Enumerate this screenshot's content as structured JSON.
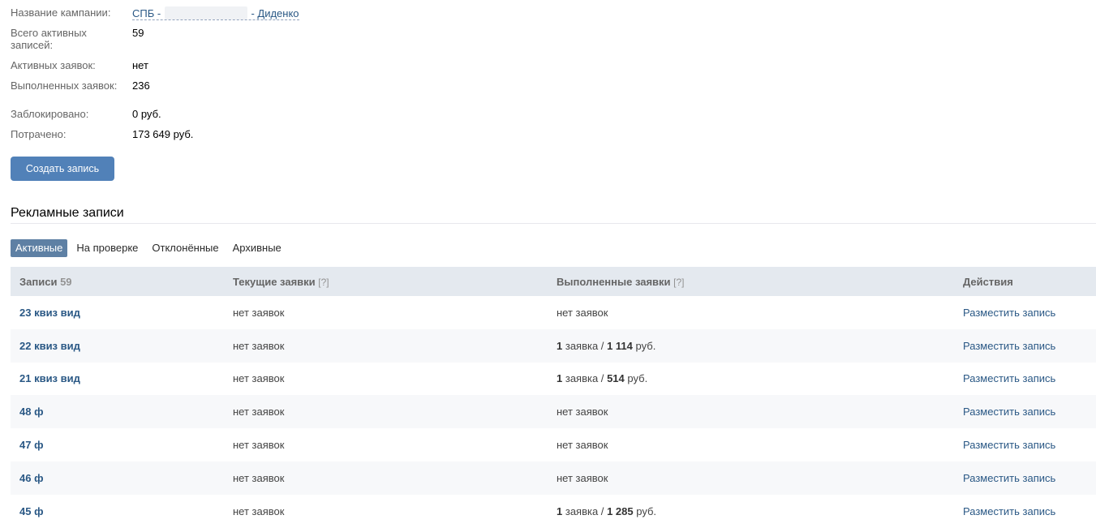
{
  "campaign": {
    "name_label": "Название кампании:",
    "name_prefix": "СПБ -",
    "name_suffix": "- Диденко",
    "active_label": "Всего активных записей:",
    "active_value": "59",
    "active_req_label": "Активных заявок:",
    "active_req_value": "нет",
    "done_req_label": "Выполненных заявок:",
    "done_req_value": "236",
    "blocked_label": "Заблокировано:",
    "blocked_value": "0 руб.",
    "spent_label": "Потрачено:",
    "spent_value": "173 649 руб."
  },
  "create_button": "Создать запись",
  "section_title": "Рекламные записи",
  "tabs": [
    "Активные",
    "На проверке",
    "Отклонённые",
    "Архивные"
  ],
  "table": {
    "headers": {
      "posts": "Записи",
      "posts_count": "59",
      "current": "Текущие заявки",
      "done": "Выполненные заявки",
      "hint": "[?]",
      "actions": "Действия"
    },
    "rows": [
      {
        "name": "23 квиз вид",
        "current": "нет заявок",
        "done_none": "нет заявок",
        "action": "Разместить запись"
      },
      {
        "name": "22 квиз вид",
        "current": "нет заявок",
        "done_count": "1",
        "done_mid": "заявка /",
        "done_sum": "1 114",
        "done_unit": "руб.",
        "action": "Разместить запись"
      },
      {
        "name": "21 квиз вид",
        "current": "нет заявок",
        "done_count": "1",
        "done_mid": "заявка /",
        "done_sum": "514",
        "done_unit": "руб.",
        "action": "Разместить запись"
      },
      {
        "name": "48 ф",
        "current": "нет заявок",
        "done_none": "нет заявок",
        "action": "Разместить запись"
      },
      {
        "name": "47 ф",
        "current": "нет заявок",
        "done_none": "нет заявок",
        "action": "Разместить запись"
      },
      {
        "name": "46 ф",
        "current": "нет заявок",
        "done_none": "нет заявок",
        "action": "Разместить запись"
      },
      {
        "name": "45 ф",
        "current": "нет заявок",
        "done_count": "1",
        "done_mid": "заявка /",
        "done_sum": "1 285",
        "done_unit": "руб.",
        "action": "Разместить запись"
      }
    ]
  }
}
